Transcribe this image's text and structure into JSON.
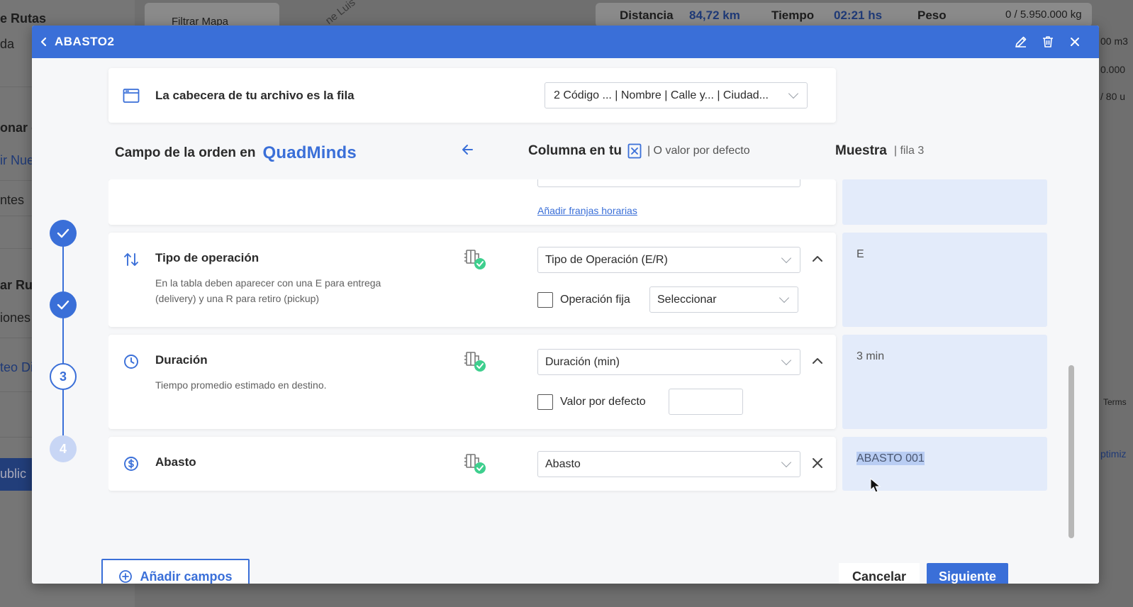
{
  "background": {
    "sidebar_texts": [
      "e Rutas",
      "da",
      "onar c",
      "ir Nue",
      "ntes",
      "ar Ruta",
      "iones",
      "teo Di",
      "ublic"
    ],
    "filter_map": "Filtrar Mapa",
    "street_label": "ne Luis",
    "stats": {
      "distance_label": "Distancia",
      "distance_value": "84,72 km",
      "time_label": "Tiempo",
      "time_value": "02:21 hs",
      "weight_label": "Peso",
      "weight_value": "0 / 5.950.000 kg"
    },
    "right_texts": [
      "00 m3",
      "0.000",
      "/ 80 u",
      "Terms",
      "ptimiz"
    ]
  },
  "modal": {
    "title": "ABASTO2",
    "header_row": {
      "label": "La cabecera de tu archivo es la fila",
      "value": "2 Código ... | Nombre | Calle y... | Ciudad..."
    },
    "columns": {
      "field_label": "Campo de la orden en",
      "brand": "QuadMinds",
      "column_label": "Columna en tu",
      "column_sub": "| O valor por defecto",
      "sample_label": "Muestra",
      "sample_sub": "| fila 3"
    },
    "stepper": {
      "steps": [
        "",
        "",
        "3",
        "4"
      ]
    },
    "time_windows_link": "Añadir franjas horarias",
    "fields": [
      {
        "title": "Tipo de operación",
        "description": "En la tabla deben aparecer con una E para entrega (delivery) y una R para retiro (pickup)",
        "column": "Tipo de Operación (E/R)",
        "checkbox_label": "Operación fija",
        "secondary_select": "Seleccionar",
        "sample": "E"
      },
      {
        "title": "Duración",
        "description": "Tiempo promedio estimado en destino.",
        "column": "Duración (min)",
        "checkbox_label": "Valor por defecto",
        "sample": "3 min"
      },
      {
        "title": "Abasto",
        "column": "Abasto",
        "sample": "ABASTO 001"
      }
    ],
    "footer": {
      "add_fields": "Añadir campos",
      "cancel": "Cancelar",
      "next": "Siguiente"
    }
  },
  "colors": {
    "primary": "#3a6fd8",
    "sample_bg": "#e3ebfa",
    "success": "#3ecf8e"
  }
}
